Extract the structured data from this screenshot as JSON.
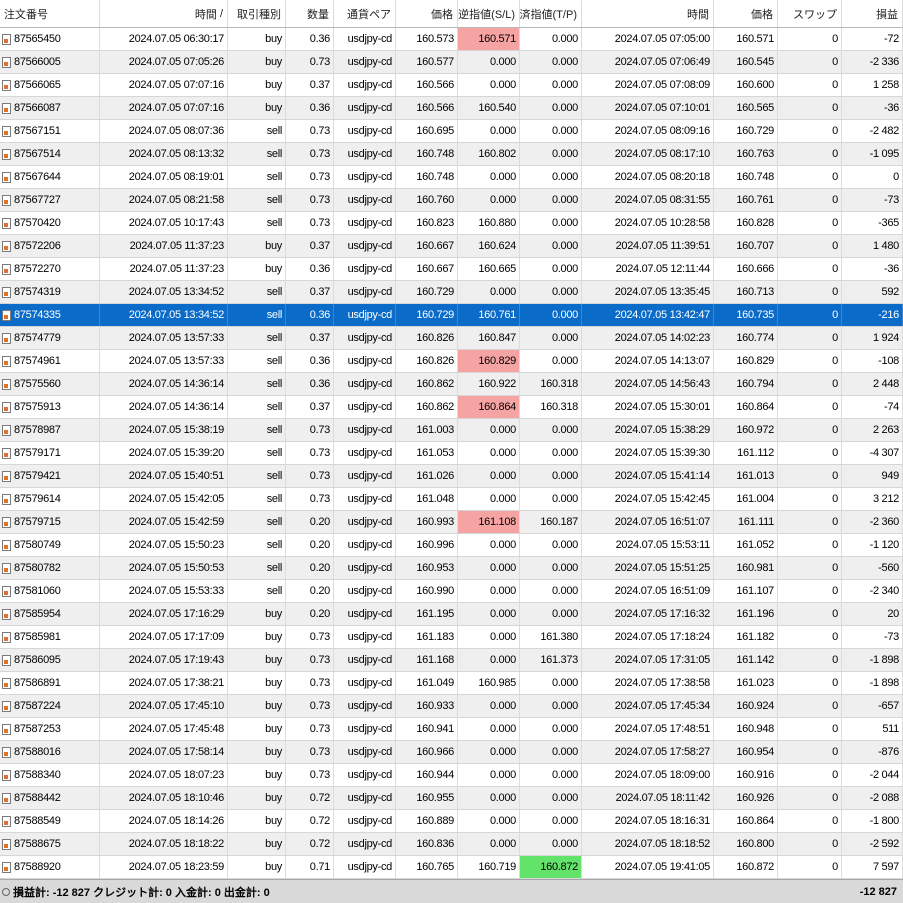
{
  "columns": [
    "注文番号",
    "時間",
    "取引種別",
    "数量",
    "通貨ペア",
    "価格",
    "決済逆指値(S/L)",
    "決済指値(T/P)",
    "時間",
    "価格",
    "スワップ",
    "損益"
  ],
  "sort_indicator": "/",
  "rows": [
    {
      "order": "87565450",
      "open_time": "2024.07.05 06:30:17",
      "type": "buy",
      "volume": "0.36",
      "symbol": "usdjpy-cd",
      "open_price": "160.573",
      "sl": "160.571",
      "tp": "0.000",
      "close_time": "2024.07.05 07:05:00",
      "close_price": "160.571",
      "swap": "0",
      "profit": "-72",
      "sl_hl": "red",
      "tp_hl": ""
    },
    {
      "order": "87566005",
      "open_time": "2024.07.05 07:05:26",
      "type": "buy",
      "volume": "0.73",
      "symbol": "usdjpy-cd",
      "open_price": "160.577",
      "sl": "0.000",
      "tp": "0.000",
      "close_time": "2024.07.05 07:06:49",
      "close_price": "160.545",
      "swap": "0",
      "profit": "-2 336",
      "sl_hl": "",
      "tp_hl": ""
    },
    {
      "order": "87566065",
      "open_time": "2024.07.05 07:07:16",
      "type": "buy",
      "volume": "0.37",
      "symbol": "usdjpy-cd",
      "open_price": "160.566",
      "sl": "0.000",
      "tp": "0.000",
      "close_time": "2024.07.05 07:08:09",
      "close_price": "160.600",
      "swap": "0",
      "profit": "1 258",
      "sl_hl": "",
      "tp_hl": ""
    },
    {
      "order": "87566087",
      "open_time": "2024.07.05 07:07:16",
      "type": "buy",
      "volume": "0.36",
      "symbol": "usdjpy-cd",
      "open_price": "160.566",
      "sl": "160.540",
      "tp": "0.000",
      "close_time": "2024.07.05 07:10:01",
      "close_price": "160.565",
      "swap": "0",
      "profit": "-36",
      "sl_hl": "",
      "tp_hl": ""
    },
    {
      "order": "87567151",
      "open_time": "2024.07.05 08:07:36",
      "type": "sell",
      "volume": "0.73",
      "symbol": "usdjpy-cd",
      "open_price": "160.695",
      "sl": "0.000",
      "tp": "0.000",
      "close_time": "2024.07.05 08:09:16",
      "close_price": "160.729",
      "swap": "0",
      "profit": "-2 482",
      "sl_hl": "",
      "tp_hl": ""
    },
    {
      "order": "87567514",
      "open_time": "2024.07.05 08:13:32",
      "type": "sell",
      "volume": "0.73",
      "symbol": "usdjpy-cd",
      "open_price": "160.748",
      "sl": "160.802",
      "tp": "0.000",
      "close_time": "2024.07.05 08:17:10",
      "close_price": "160.763",
      "swap": "0",
      "profit": "-1 095",
      "sl_hl": "",
      "tp_hl": ""
    },
    {
      "order": "87567644",
      "open_time": "2024.07.05 08:19:01",
      "type": "sell",
      "volume": "0.73",
      "symbol": "usdjpy-cd",
      "open_price": "160.748",
      "sl": "0.000",
      "tp": "0.000",
      "close_time": "2024.07.05 08:20:18",
      "close_price": "160.748",
      "swap": "0",
      "profit": "0",
      "sl_hl": "",
      "tp_hl": ""
    },
    {
      "order": "87567727",
      "open_time": "2024.07.05 08:21:58",
      "type": "sell",
      "volume": "0.73",
      "symbol": "usdjpy-cd",
      "open_price": "160.760",
      "sl": "0.000",
      "tp": "0.000",
      "close_time": "2024.07.05 08:31:55",
      "close_price": "160.761",
      "swap": "0",
      "profit": "-73",
      "sl_hl": "",
      "tp_hl": ""
    },
    {
      "order": "87570420",
      "open_time": "2024.07.05 10:17:43",
      "type": "sell",
      "volume": "0.73",
      "symbol": "usdjpy-cd",
      "open_price": "160.823",
      "sl": "160.880",
      "tp": "0.000",
      "close_time": "2024.07.05 10:28:58",
      "close_price": "160.828",
      "swap": "0",
      "profit": "-365",
      "sl_hl": "",
      "tp_hl": ""
    },
    {
      "order": "87572206",
      "open_time": "2024.07.05 11:37:23",
      "type": "buy",
      "volume": "0.37",
      "symbol": "usdjpy-cd",
      "open_price": "160.667",
      "sl": "160.624",
      "tp": "0.000",
      "close_time": "2024.07.05 11:39:51",
      "close_price": "160.707",
      "swap": "0",
      "profit": "1 480",
      "sl_hl": "",
      "tp_hl": ""
    },
    {
      "order": "87572270",
      "open_time": "2024.07.05 11:37:23",
      "type": "buy",
      "volume": "0.36",
      "symbol": "usdjpy-cd",
      "open_price": "160.667",
      "sl": "160.665",
      "tp": "0.000",
      "close_time": "2024.07.05 12:11:44",
      "close_price": "160.666",
      "swap": "0",
      "profit": "-36",
      "sl_hl": "",
      "tp_hl": ""
    },
    {
      "order": "87574319",
      "open_time": "2024.07.05 13:34:52",
      "type": "sell",
      "volume": "0.37",
      "symbol": "usdjpy-cd",
      "open_price": "160.729",
      "sl": "0.000",
      "tp": "0.000",
      "close_time": "2024.07.05 13:35:45",
      "close_price": "160.713",
      "swap": "0",
      "profit": "592",
      "sl_hl": "",
      "tp_hl": ""
    },
    {
      "order": "87574335",
      "open_time": "2024.07.05 13:34:52",
      "type": "sell",
      "volume": "0.36",
      "symbol": "usdjpy-cd",
      "open_price": "160.729",
      "sl": "160.761",
      "tp": "0.000",
      "close_time": "2024.07.05 13:42:47",
      "close_price": "160.735",
      "swap": "0",
      "profit": "-216",
      "sl_hl": "",
      "tp_hl": "",
      "selected": true
    },
    {
      "order": "87574779",
      "open_time": "2024.07.05 13:57:33",
      "type": "sell",
      "volume": "0.37",
      "symbol": "usdjpy-cd",
      "open_price": "160.826",
      "sl": "160.847",
      "tp": "0.000",
      "close_time": "2024.07.05 14:02:23",
      "close_price": "160.774",
      "swap": "0",
      "profit": "1 924",
      "sl_hl": "",
      "tp_hl": ""
    },
    {
      "order": "87574961",
      "open_time": "2024.07.05 13:57:33",
      "type": "sell",
      "volume": "0.36",
      "symbol": "usdjpy-cd",
      "open_price": "160.826",
      "sl": "160.829",
      "tp": "0.000",
      "close_time": "2024.07.05 14:13:07",
      "close_price": "160.829",
      "swap": "0",
      "profit": "-108",
      "sl_hl": "red",
      "tp_hl": ""
    },
    {
      "order": "87575560",
      "open_time": "2024.07.05 14:36:14",
      "type": "sell",
      "volume": "0.36",
      "symbol": "usdjpy-cd",
      "open_price": "160.862",
      "sl": "160.922",
      "tp": "160.318",
      "close_time": "2024.07.05 14:56:43",
      "close_price": "160.794",
      "swap": "0",
      "profit": "2 448",
      "sl_hl": "",
      "tp_hl": ""
    },
    {
      "order": "87575913",
      "open_time": "2024.07.05 14:36:14",
      "type": "sell",
      "volume": "0.37",
      "symbol": "usdjpy-cd",
      "open_price": "160.862",
      "sl": "160.864",
      "tp": "160.318",
      "close_time": "2024.07.05 15:30:01",
      "close_price": "160.864",
      "swap": "0",
      "profit": "-74",
      "sl_hl": "red",
      "tp_hl": ""
    },
    {
      "order": "87578987",
      "open_time": "2024.07.05 15:38:19",
      "type": "sell",
      "volume": "0.73",
      "symbol": "usdjpy-cd",
      "open_price": "161.003",
      "sl": "0.000",
      "tp": "0.000",
      "close_time": "2024.07.05 15:38:29",
      "close_price": "160.972",
      "swap": "0",
      "profit": "2 263",
      "sl_hl": "",
      "tp_hl": ""
    },
    {
      "order": "87579171",
      "open_time": "2024.07.05 15:39:20",
      "type": "sell",
      "volume": "0.73",
      "symbol": "usdjpy-cd",
      "open_price": "161.053",
      "sl": "0.000",
      "tp": "0.000",
      "close_time": "2024.07.05 15:39:30",
      "close_price": "161.112",
      "swap": "0",
      "profit": "-4 307",
      "sl_hl": "",
      "tp_hl": ""
    },
    {
      "order": "87579421",
      "open_time": "2024.07.05 15:40:51",
      "type": "sell",
      "volume": "0.73",
      "symbol": "usdjpy-cd",
      "open_price": "161.026",
      "sl": "0.000",
      "tp": "0.000",
      "close_time": "2024.07.05 15:41:14",
      "close_price": "161.013",
      "swap": "0",
      "profit": "949",
      "sl_hl": "",
      "tp_hl": ""
    },
    {
      "order": "87579614",
      "open_time": "2024.07.05 15:42:05",
      "type": "sell",
      "volume": "0.73",
      "symbol": "usdjpy-cd",
      "open_price": "161.048",
      "sl": "0.000",
      "tp": "0.000",
      "close_time": "2024.07.05 15:42:45",
      "close_price": "161.004",
      "swap": "0",
      "profit": "3 212",
      "sl_hl": "",
      "tp_hl": ""
    },
    {
      "order": "87579715",
      "open_time": "2024.07.05 15:42:59",
      "type": "sell",
      "volume": "0.20",
      "symbol": "usdjpy-cd",
      "open_price": "160.993",
      "sl": "161.108",
      "tp": "160.187",
      "close_time": "2024.07.05 16:51:07",
      "close_price": "161.111",
      "swap": "0",
      "profit": "-2 360",
      "sl_hl": "red",
      "tp_hl": ""
    },
    {
      "order": "87580749",
      "open_time": "2024.07.05 15:50:23",
      "type": "sell",
      "volume": "0.20",
      "symbol": "usdjpy-cd",
      "open_price": "160.996",
      "sl": "0.000",
      "tp": "0.000",
      "close_time": "2024.07.05 15:53:11",
      "close_price": "161.052",
      "swap": "0",
      "profit": "-1 120",
      "sl_hl": "",
      "tp_hl": ""
    },
    {
      "order": "87580782",
      "open_time": "2024.07.05 15:50:53",
      "type": "sell",
      "volume": "0.20",
      "symbol": "usdjpy-cd",
      "open_price": "160.953",
      "sl": "0.000",
      "tp": "0.000",
      "close_time": "2024.07.05 15:51:25",
      "close_price": "160.981",
      "swap": "0",
      "profit": "-560",
      "sl_hl": "",
      "tp_hl": ""
    },
    {
      "order": "87581060",
      "open_time": "2024.07.05 15:53:33",
      "type": "sell",
      "volume": "0.20",
      "symbol": "usdjpy-cd",
      "open_price": "160.990",
      "sl": "0.000",
      "tp": "0.000",
      "close_time": "2024.07.05 16:51:09",
      "close_price": "161.107",
      "swap": "0",
      "profit": "-2 340",
      "sl_hl": "",
      "tp_hl": ""
    },
    {
      "order": "87585954",
      "open_time": "2024.07.05 17:16:29",
      "type": "buy",
      "volume": "0.20",
      "symbol": "usdjpy-cd",
      "open_price": "161.195",
      "sl": "0.000",
      "tp": "0.000",
      "close_time": "2024.07.05 17:16:32",
      "close_price": "161.196",
      "swap": "0",
      "profit": "20",
      "sl_hl": "",
      "tp_hl": ""
    },
    {
      "order": "87585981",
      "open_time": "2024.07.05 17:17:09",
      "type": "buy",
      "volume": "0.73",
      "symbol": "usdjpy-cd",
      "open_price": "161.183",
      "sl": "0.000",
      "tp": "161.380",
      "close_time": "2024.07.05 17:18:24",
      "close_price": "161.182",
      "swap": "0",
      "profit": "-73",
      "sl_hl": "",
      "tp_hl": ""
    },
    {
      "order": "87586095",
      "open_time": "2024.07.05 17:19:43",
      "type": "buy",
      "volume": "0.73",
      "symbol": "usdjpy-cd",
      "open_price": "161.168",
      "sl": "0.000",
      "tp": "161.373",
      "close_time": "2024.07.05 17:31:05",
      "close_price": "161.142",
      "swap": "0",
      "profit": "-1 898",
      "sl_hl": "",
      "tp_hl": ""
    },
    {
      "order": "87586891",
      "open_time": "2024.07.05 17:38:21",
      "type": "buy",
      "volume": "0.73",
      "symbol": "usdjpy-cd",
      "open_price": "161.049",
      "sl": "160.985",
      "tp": "0.000",
      "close_time": "2024.07.05 17:38:58",
      "close_price": "161.023",
      "swap": "0",
      "profit": "-1 898",
      "sl_hl": "",
      "tp_hl": ""
    },
    {
      "order": "87587224",
      "open_time": "2024.07.05 17:45:10",
      "type": "buy",
      "volume": "0.73",
      "symbol": "usdjpy-cd",
      "open_price": "160.933",
      "sl": "0.000",
      "tp": "0.000",
      "close_time": "2024.07.05 17:45:34",
      "close_price": "160.924",
      "swap": "0",
      "profit": "-657",
      "sl_hl": "",
      "tp_hl": ""
    },
    {
      "order": "87587253",
      "open_time": "2024.07.05 17:45:48",
      "type": "buy",
      "volume": "0.73",
      "symbol": "usdjpy-cd",
      "open_price": "160.941",
      "sl": "0.000",
      "tp": "0.000",
      "close_time": "2024.07.05 17:48:51",
      "close_price": "160.948",
      "swap": "0",
      "profit": "511",
      "sl_hl": "",
      "tp_hl": ""
    },
    {
      "order": "87588016",
      "open_time": "2024.07.05 17:58:14",
      "type": "buy",
      "volume": "0.73",
      "symbol": "usdjpy-cd",
      "open_price": "160.966",
      "sl": "0.000",
      "tp": "0.000",
      "close_time": "2024.07.05 17:58:27",
      "close_price": "160.954",
      "swap": "0",
      "profit": "-876",
      "sl_hl": "",
      "tp_hl": ""
    },
    {
      "order": "87588340",
      "open_time": "2024.07.05 18:07:23",
      "type": "buy",
      "volume": "0.73",
      "symbol": "usdjpy-cd",
      "open_price": "160.944",
      "sl": "0.000",
      "tp": "0.000",
      "close_time": "2024.07.05 18:09:00",
      "close_price": "160.916",
      "swap": "0",
      "profit": "-2 044",
      "sl_hl": "",
      "tp_hl": ""
    },
    {
      "order": "87588442",
      "open_time": "2024.07.05 18:10:46",
      "type": "buy",
      "volume": "0.72",
      "symbol": "usdjpy-cd",
      "open_price": "160.955",
      "sl": "0.000",
      "tp": "0.000",
      "close_time": "2024.07.05 18:11:42",
      "close_price": "160.926",
      "swap": "0",
      "profit": "-2 088",
      "sl_hl": "",
      "tp_hl": ""
    },
    {
      "order": "87588549",
      "open_time": "2024.07.05 18:14:26",
      "type": "buy",
      "volume": "0.72",
      "symbol": "usdjpy-cd",
      "open_price": "160.889",
      "sl": "0.000",
      "tp": "0.000",
      "close_time": "2024.07.05 18:16:31",
      "close_price": "160.864",
      "swap": "0",
      "profit": "-1 800",
      "sl_hl": "",
      "tp_hl": ""
    },
    {
      "order": "87588675",
      "open_time": "2024.07.05 18:18:22",
      "type": "buy",
      "volume": "0.72",
      "symbol": "usdjpy-cd",
      "open_price": "160.836",
      "sl": "0.000",
      "tp": "0.000",
      "close_time": "2024.07.05 18:18:52",
      "close_price": "160.800",
      "swap": "0",
      "profit": "-2 592",
      "sl_hl": "",
      "tp_hl": ""
    },
    {
      "order": "87588920",
      "open_time": "2024.07.05 18:23:59",
      "type": "buy",
      "volume": "0.71",
      "symbol": "usdjpy-cd",
      "open_price": "160.765",
      "sl": "160.719",
      "tp": "160.872",
      "close_time": "2024.07.05 19:41:05",
      "close_price": "160.872",
      "swap": "0",
      "profit": "7 597",
      "sl_hl": "",
      "tp_hl": "green"
    }
  ],
  "status": {
    "summary": "損益計: -12 827  クレジット計: 0  入金計: 0  出金計: 0",
    "total": "-12 827"
  },
  "colors": {
    "selected_row": "#0a6bc9",
    "sl_hit": "#f6a3a3",
    "tp_hit": "#62e36a"
  },
  "icons": {
    "row": "order-document-icon"
  }
}
